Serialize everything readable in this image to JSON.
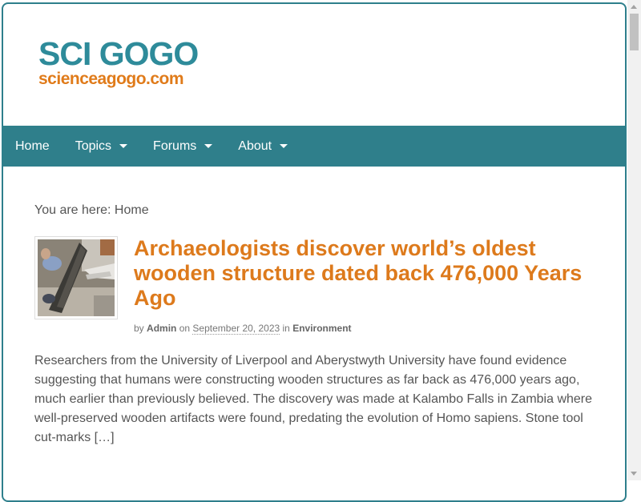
{
  "site": {
    "title": "SCI GOGO",
    "subtitle": "scienceagogo.com"
  },
  "nav": {
    "items": [
      {
        "label": "Home",
        "dropdown": false
      },
      {
        "label": "Topics",
        "dropdown": true
      },
      {
        "label": "Forums",
        "dropdown": true
      },
      {
        "label": "About",
        "dropdown": true
      }
    ]
  },
  "breadcrumb": {
    "text": "You are here: Home"
  },
  "article": {
    "title": "Archaeologists discover world’s oldest wooden structure dated back 476,000 Years Ago",
    "meta_by": "by",
    "author": "Admin",
    "meta_on": "on",
    "date": "September 20, 2023",
    "meta_in": "in",
    "category": "Environment",
    "excerpt": "Researchers from the University of Liverpool and Aberystwyth University have found evidence suggesting that humans were constructing wooden structures as far back as 476,000 years ago, much earlier than previously believed. The discovery was made at Kalambo Falls in Zambia where well-preserved wooden artifacts were found, predating the evolution of Homo sapiens. Stone tool cut-marks […]"
  },
  "colors": {
    "brand_teal": "#2e8b9a",
    "brand_orange": "#e07b1a",
    "nav_bg": "#2f7f8b",
    "title_orange": "#dd7a1c"
  }
}
